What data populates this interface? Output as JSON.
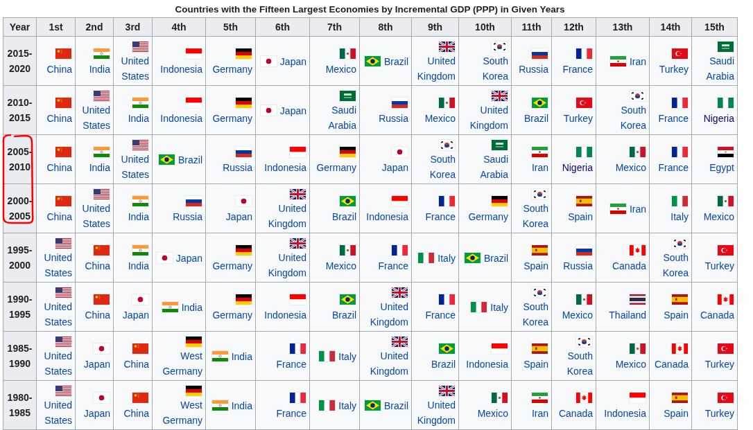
{
  "caption": "Countries with the Fifteen Largest Economies by Incremental GDP (PPP) in Given Years",
  "columns": [
    "Year",
    "1st",
    "2nd",
    "3rd",
    "4th",
    "5th",
    "6th",
    "7th",
    "8th",
    "9th",
    "10th",
    "11th",
    "12th",
    "13th",
    "14th",
    "15th"
  ],
  "rows": [
    {
      "year": "2015-2020",
      "cells": [
        {
          "country": "China",
          "kind": "cn",
          "visited": false
        },
        {
          "country": "India",
          "kind": "in",
          "visited": false
        },
        {
          "country": "United States",
          "kind": "us",
          "visited": false
        },
        {
          "country": "Indonesia",
          "kind": "id",
          "visited": false
        },
        {
          "country": "Germany",
          "kind": "de",
          "visited": false
        },
        {
          "country": "Japan",
          "kind": "jp",
          "visited": false
        },
        {
          "country": "Mexico",
          "kind": "mx",
          "visited": false
        },
        {
          "country": "Brazil",
          "kind": "br",
          "visited": false
        },
        {
          "country": "United Kingdom",
          "kind": "gb",
          "visited": false
        },
        {
          "country": "South Korea",
          "kind": "kr",
          "visited": false
        },
        {
          "country": "Russia",
          "kind": "ru",
          "visited": false
        },
        {
          "country": "France",
          "kind": "fr",
          "visited": false
        },
        {
          "country": "Iran",
          "kind": "ir",
          "visited": false
        },
        {
          "country": "Turkey",
          "kind": "tr",
          "visited": false
        },
        {
          "country": "Saudi Arabia",
          "kind": "sa",
          "visited": false
        }
      ]
    },
    {
      "year": "2010-2015",
      "cells": [
        {
          "country": "China",
          "kind": "cn",
          "visited": false
        },
        {
          "country": "United States",
          "kind": "us",
          "visited": false
        },
        {
          "country": "India",
          "kind": "in",
          "visited": false
        },
        {
          "country": "Indonesia",
          "kind": "id",
          "visited": false
        },
        {
          "country": "Germany",
          "kind": "de",
          "visited": false
        },
        {
          "country": "Japan",
          "kind": "jp",
          "visited": false
        },
        {
          "country": "Saudi Arabia",
          "kind": "sa",
          "visited": false
        },
        {
          "country": "Russia",
          "kind": "ru",
          "visited": false
        },
        {
          "country": "Mexico",
          "kind": "mx",
          "visited": false
        },
        {
          "country": "United Kingdom",
          "kind": "gb",
          "visited": false
        },
        {
          "country": "Brazil",
          "kind": "br",
          "visited": false
        },
        {
          "country": "Turkey",
          "kind": "tr",
          "visited": false
        },
        {
          "country": "South Korea",
          "kind": "kr",
          "visited": false
        },
        {
          "country": "France",
          "kind": "fr",
          "visited": false
        },
        {
          "country": "Nigeria",
          "kind": "ng",
          "visited": true
        }
      ]
    },
    {
      "year": "2005-2010",
      "cells": [
        {
          "country": "China",
          "kind": "cn",
          "visited": false
        },
        {
          "country": "India",
          "kind": "in",
          "visited": false
        },
        {
          "country": "United States",
          "kind": "us",
          "visited": false
        },
        {
          "country": "Brazil",
          "kind": "br",
          "visited": false
        },
        {
          "country": "Russia",
          "kind": "ru",
          "visited": false
        },
        {
          "country": "Indonesia",
          "kind": "id",
          "visited": false
        },
        {
          "country": "Germany",
          "kind": "de",
          "visited": false
        },
        {
          "country": "Japan",
          "kind": "jp",
          "visited": false
        },
        {
          "country": "South Korea",
          "kind": "kr",
          "visited": false
        },
        {
          "country": "Saudi Arabia",
          "kind": "sa",
          "visited": false
        },
        {
          "country": "Iran",
          "kind": "ir",
          "visited": false
        },
        {
          "country": "Nigeria",
          "kind": "ng",
          "visited": true
        },
        {
          "country": "Mexico",
          "kind": "mx",
          "visited": false
        },
        {
          "country": "France",
          "kind": "fr",
          "visited": false
        },
        {
          "country": "Egypt",
          "kind": "eg",
          "visited": false
        }
      ]
    },
    {
      "year": "2000-2005",
      "cells": [
        {
          "country": "China",
          "kind": "cn",
          "visited": false
        },
        {
          "country": "United States",
          "kind": "us",
          "visited": false
        },
        {
          "country": "India",
          "kind": "in",
          "visited": false
        },
        {
          "country": "Russia",
          "kind": "ru",
          "visited": false
        },
        {
          "country": "Japan",
          "kind": "jp",
          "visited": false
        },
        {
          "country": "United Kingdom",
          "kind": "gb",
          "visited": false
        },
        {
          "country": "Brazil",
          "kind": "br",
          "visited": false
        },
        {
          "country": "Indonesia",
          "kind": "id",
          "visited": false
        },
        {
          "country": "France",
          "kind": "fr",
          "visited": false
        },
        {
          "country": "Germany",
          "kind": "de",
          "visited": false
        },
        {
          "country": "South Korea",
          "kind": "kr",
          "visited": false
        },
        {
          "country": "Spain",
          "kind": "es",
          "visited": false
        },
        {
          "country": "Iran",
          "kind": "ir",
          "visited": false
        },
        {
          "country": "Italy",
          "kind": "it",
          "visited": false
        },
        {
          "country": "Mexico",
          "kind": "mx",
          "visited": false
        }
      ]
    },
    {
      "year": "1995-2000",
      "cells": [
        {
          "country": "United States",
          "kind": "us",
          "visited": false
        },
        {
          "country": "China",
          "kind": "cn",
          "visited": false
        },
        {
          "country": "India",
          "kind": "in",
          "visited": false
        },
        {
          "country": "Japan",
          "kind": "jp",
          "visited": false
        },
        {
          "country": "Germany",
          "kind": "de",
          "visited": false
        },
        {
          "country": "United Kingdom",
          "kind": "gb",
          "visited": false
        },
        {
          "country": "Mexico",
          "kind": "mx",
          "visited": false
        },
        {
          "country": "France",
          "kind": "fr",
          "visited": false
        },
        {
          "country": "Italy",
          "kind": "it",
          "visited": false
        },
        {
          "country": "Brazil",
          "kind": "br",
          "visited": false
        },
        {
          "country": "Spain",
          "kind": "es",
          "visited": false
        },
        {
          "country": "Russia",
          "kind": "ru",
          "visited": false
        },
        {
          "country": "Canada",
          "kind": "ca",
          "visited": false
        },
        {
          "country": "South Korea",
          "kind": "kr",
          "visited": false
        },
        {
          "country": "Turkey",
          "kind": "tr",
          "visited": false
        }
      ]
    },
    {
      "year": "1990-1995",
      "cells": [
        {
          "country": "United States",
          "kind": "us",
          "visited": false
        },
        {
          "country": "China",
          "kind": "cn",
          "visited": false
        },
        {
          "country": "Japan",
          "kind": "jp",
          "visited": false
        },
        {
          "country": "India",
          "kind": "in",
          "visited": false
        },
        {
          "country": "Germany",
          "kind": "de",
          "visited": false
        },
        {
          "country": "Indonesia",
          "kind": "id",
          "visited": false
        },
        {
          "country": "Brazil",
          "kind": "br",
          "visited": false
        },
        {
          "country": "United Kingdom",
          "kind": "gb",
          "visited": false
        },
        {
          "country": "France",
          "kind": "fr",
          "visited": false
        },
        {
          "country": "Italy",
          "kind": "it",
          "visited": false
        },
        {
          "country": "South Korea",
          "kind": "kr",
          "visited": false
        },
        {
          "country": "Mexico",
          "kind": "mx",
          "visited": false
        },
        {
          "country": "Thailand",
          "kind": "th",
          "visited": false
        },
        {
          "country": "Spain",
          "kind": "es",
          "visited": false
        },
        {
          "country": "Canada",
          "kind": "ca",
          "visited": false
        }
      ]
    },
    {
      "year": "1985-1990",
      "cells": [
        {
          "country": "United States",
          "kind": "us",
          "visited": false
        },
        {
          "country": "Japan",
          "kind": "jp",
          "visited": false
        },
        {
          "country": "China",
          "kind": "cn",
          "visited": false
        },
        {
          "country": "West Germany",
          "kind": "de",
          "visited": false
        },
        {
          "country": "India",
          "kind": "in",
          "visited": false
        },
        {
          "country": "France",
          "kind": "fr",
          "visited": false
        },
        {
          "country": "Italy",
          "kind": "it",
          "visited": false
        },
        {
          "country": "United Kingdom",
          "kind": "gb",
          "visited": false
        },
        {
          "country": "Brazil",
          "kind": "br",
          "visited": false
        },
        {
          "country": "Indonesia",
          "kind": "id",
          "visited": false
        },
        {
          "country": "Spain",
          "kind": "es",
          "visited": false
        },
        {
          "country": "South Korea",
          "kind": "kr",
          "visited": false
        },
        {
          "country": "Mexico",
          "kind": "mx",
          "visited": false
        },
        {
          "country": "Canada",
          "kind": "ca",
          "visited": false
        },
        {
          "country": "Turkey",
          "kind": "tr",
          "visited": false
        }
      ]
    },
    {
      "year": "1980-1985",
      "cells": [
        {
          "country": "United States",
          "kind": "us",
          "visited": false
        },
        {
          "country": "Japan",
          "kind": "jp",
          "visited": false
        },
        {
          "country": "China",
          "kind": "cn",
          "visited": false
        },
        {
          "country": "West Germany",
          "kind": "de",
          "visited": false
        },
        {
          "country": "India",
          "kind": "in",
          "visited": false
        },
        {
          "country": "France",
          "kind": "fr",
          "visited": false
        },
        {
          "country": "Italy",
          "kind": "it",
          "visited": false
        },
        {
          "country": "Brazil",
          "kind": "br",
          "visited": false
        },
        {
          "country": "United Kingdom",
          "kind": "gb",
          "visited": false
        },
        {
          "country": "Mexico",
          "kind": "mx",
          "visited": false
        },
        {
          "country": "Iran",
          "kind": "ir",
          "visited": false
        },
        {
          "country": "Canada",
          "kind": "ca",
          "visited": false
        },
        {
          "country": "Indonesia",
          "kind": "id",
          "visited": false
        },
        {
          "country": "Spain",
          "kind": "es",
          "visited": false
        },
        {
          "country": "Turkey",
          "kind": "tr",
          "visited": false
        }
      ]
    }
  ]
}
